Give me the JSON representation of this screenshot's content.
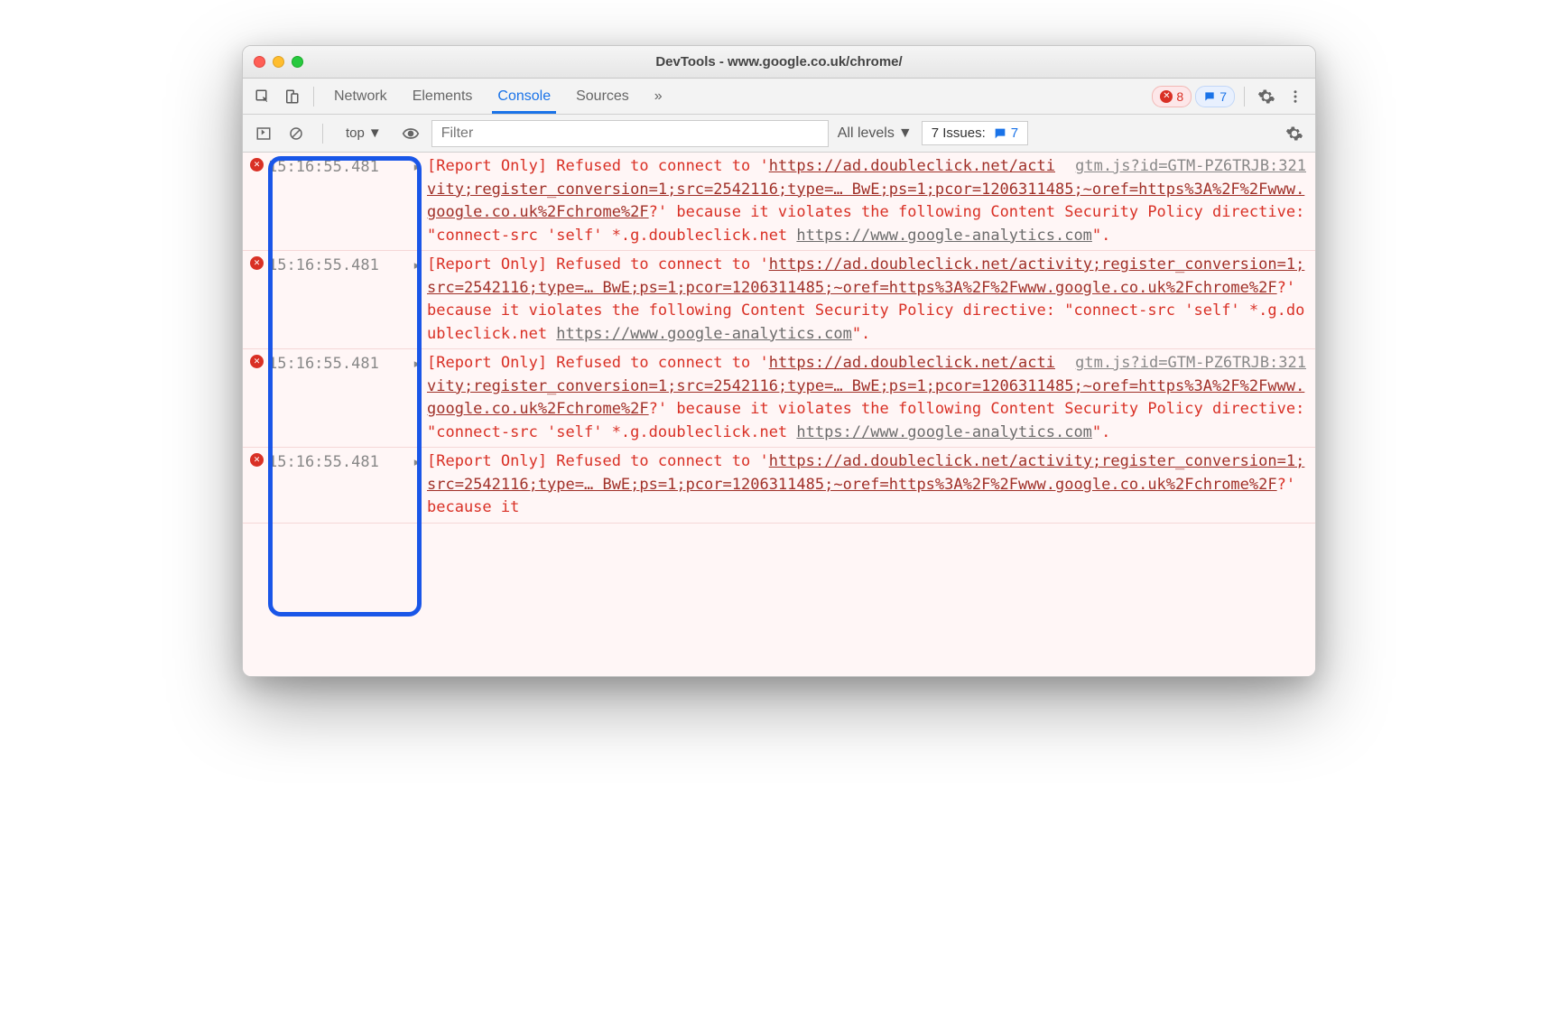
{
  "window": {
    "title": "DevTools - www.google.co.uk/chrome/"
  },
  "toolbar": {
    "tabs": [
      "Network",
      "Elements",
      "Console",
      "Sources"
    ],
    "more": "»",
    "error_count": "8",
    "message_count": "7"
  },
  "subbar": {
    "context": "top",
    "filter_placeholder": "Filter",
    "levels": "All levels",
    "issues_label": "7 Issues:",
    "issues_count": "7"
  },
  "rows": [
    {
      "ts": "15:16:55.481",
      "source": "gtm.js?id=GTM-PZ6TRJB:321",
      "parts": [
        {
          "t": "plain",
          "v": "[Report Only] Refused to connect to '"
        },
        {
          "t": "u",
          "v": "https://ad.doubleclick.net/activity;register_conversion=1;src=2542116;type=… BwE;ps=1;pcor=1206311485;~oref=https%3A%2F%2Fwww.google.co.uk%2Fchrome%2F"
        },
        {
          "t": "plain",
          "v": "?' because it violates the following Content Security Policy directive: \"connect-src 'self' *.g.doubleclick.net "
        },
        {
          "t": "u2",
          "v": "https://www.google-analytics.com"
        },
        {
          "t": "plain",
          "v": "\"."
        }
      ]
    },
    {
      "ts": "15:16:55.481",
      "source": "",
      "parts": [
        {
          "t": "plain",
          "v": "[Report Only] Refused to connect to '"
        },
        {
          "t": "u",
          "v": "https://ad.doubleclick.net/activity;register_conversion=1;src=2542116;type=… BwE;ps=1;pcor=1206311485;~oref=https%3A%2F%2Fwww.google.co.uk%2Fchrome%2F"
        },
        {
          "t": "plain",
          "v": "?' because it violates the following Content Security Policy directive: \"connect-src 'self' *.g.doubleclick.net "
        },
        {
          "t": "u2",
          "v": "https://www.google-analytics.com"
        },
        {
          "t": "plain",
          "v": "\"."
        }
      ]
    },
    {
      "ts": "15:16:55.481",
      "source": "gtm.js?id=GTM-PZ6TRJB:321",
      "parts": [
        {
          "t": "plain",
          "v": "[Report Only] Refused to connect to '"
        },
        {
          "t": "u",
          "v": "https://ad.doubleclick.net/activity;register_conversion=1;src=2542116;type=… BwE;ps=1;pcor=1206311485;~oref=https%3A%2F%2Fwww.google.co.uk%2Fchrome%2F"
        },
        {
          "t": "plain",
          "v": "?' because it violates the following Content Security Policy directive: \"connect-src 'self' *.g.doubleclick.net "
        },
        {
          "t": "u2",
          "v": "https://www.google-analytics.com"
        },
        {
          "t": "plain",
          "v": "\"."
        }
      ]
    },
    {
      "ts": "15:16:55.481",
      "source": "",
      "parts": [
        {
          "t": "plain",
          "v": "[Report Only] Refused to connect to '"
        },
        {
          "t": "u",
          "v": "https://ad.doubleclick.net/activity;register_conversion=1;src=2542116;type=… BwE;ps=1;pcor=1206311485;~oref=https%3A%2F%2Fwww.google.co.uk%2Fchrome%2F"
        },
        {
          "t": "plain",
          "v": "?' because it "
        }
      ]
    }
  ]
}
